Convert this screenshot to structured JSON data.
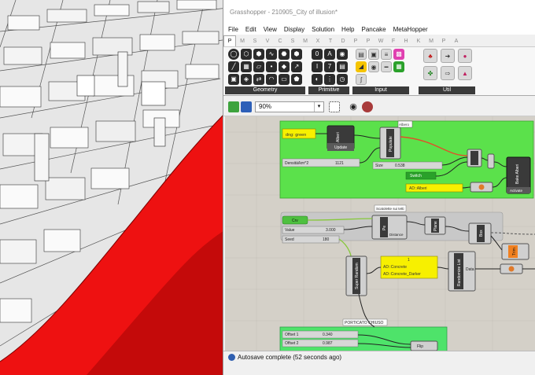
{
  "window": {
    "title": "Grasshopper - 210905_City of illusion*"
  },
  "menu": [
    "File",
    "Edit",
    "View",
    "Display",
    "Solution",
    "Help",
    "Pancake",
    "MetaHopper"
  ],
  "tabs": [
    "P",
    "M",
    "S",
    "V",
    "C",
    "S",
    "M",
    "X",
    "T",
    "D",
    "P",
    "P",
    "W",
    "F",
    "H",
    "K",
    "M",
    "P",
    "A"
  ],
  "ribbon": {
    "groups": [
      {
        "label": "Geometry"
      },
      {
        "label": "Primitive"
      },
      {
        "label": "Input"
      },
      {
        "label": "Util"
      }
    ]
  },
  "toolbar": {
    "zoom": "90%"
  },
  "canvas": {
    "green_group_top": {
      "panel_text": "dng: green",
      "density_label": "Densità/km^2",
      "density_value": "1121",
      "albero_update": "Update",
      "albero_label": "Alberi",
      "populate_label": "Populate",
      "populate_badge": "Albero",
      "size_label": "Size",
      "size_value": "0.538",
      "switch_label": "Switch",
      "ad_alberi": "AD::Alberi",
      "bake_label": "Bake Alberi",
      "activate_label": "Activate"
    },
    "group_scatolette": {
      "title": "Scatolette sui tetti",
      "value_label": "Value",
      "value_value": "3.000",
      "seed_label": "Seed",
      "seed_value": "180",
      "crv_label": "Crv",
      "pe_label": "Pe",
      "plane_label": "Plane",
      "box_label": "Box",
      "distance_label": "Distance",
      "trim_label": "Trim"
    },
    "random_group": {
      "number": "1",
      "concrete": "AD::Concrete",
      "concrete_darker": "AD::Concrete_Darker",
      "super_random": "Super Random",
      "randomize_list": "Randomize List",
      "data_label": "Data"
    },
    "portico_group": {
      "title": "PORTICATO CHIUSO",
      "offset1_label": "Offset 1",
      "offset1_value": "0.340",
      "offset2_label": "Offset 2",
      "offset2_value": "0.987",
      "flip_label": "Flip"
    }
  },
  "status": {
    "text": "Autosave complete (52 seconds ago)"
  },
  "colors": {
    "group_green": "#5be14b",
    "group_green_light": "#4ee36a",
    "group_gray": "#c8c8c8",
    "panel_yellow": "#f7f000",
    "component_dark": "#3a3a3a",
    "viewport_red": "#ee1111",
    "wire_orange": "#e0502a",
    "wire_green": "#86c83a"
  }
}
